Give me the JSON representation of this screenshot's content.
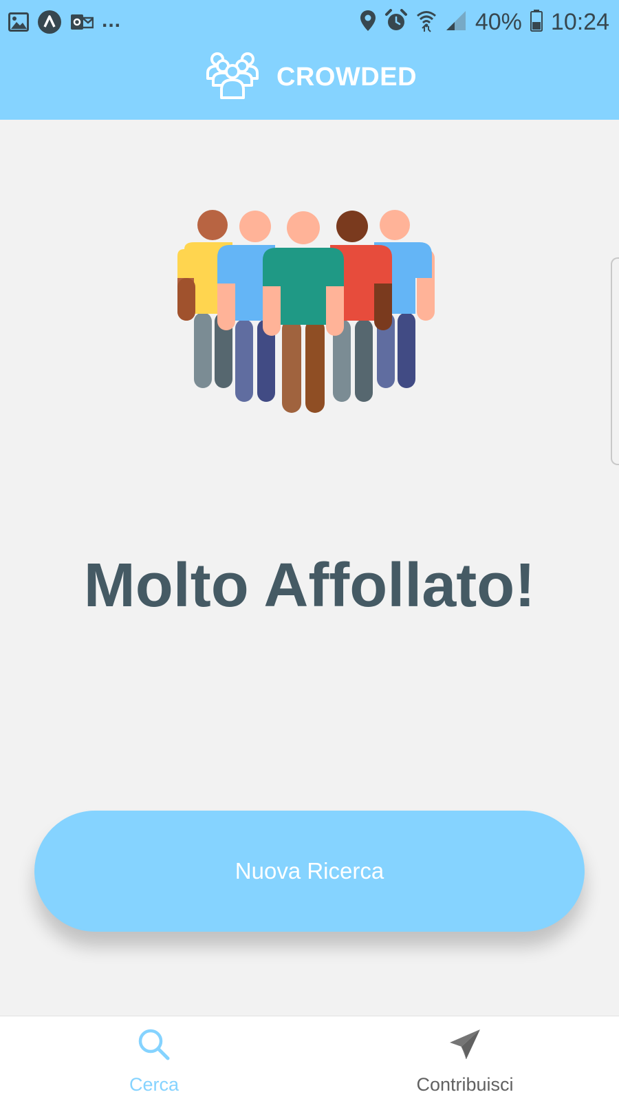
{
  "status_bar": {
    "left_icons": [
      "image-icon",
      "app-icon",
      "outlook-icon"
    ],
    "more": "...",
    "right_icons": [
      "location-icon",
      "alarm-icon",
      "wifi-icon",
      "signal-icon"
    ],
    "battery_percent": "40%",
    "time": "10:24"
  },
  "header": {
    "app_title": "CROWDED",
    "logo_icon": "crowd-logo-icon",
    "background": "#85d3ff"
  },
  "main": {
    "illustration_icon": "crowd-illustration",
    "result_title": "Molto Affollato!",
    "result_color": "#455a64",
    "button_label": "Nuova Ricerca",
    "button_color": "#85d3ff"
  },
  "bottom_nav": {
    "items": [
      {
        "label": "Cerca",
        "icon": "search-icon",
        "active": true
      },
      {
        "label": "Contribuisci",
        "icon": "send-icon",
        "active": false
      }
    ],
    "active_color": "#85d3ff",
    "inactive_color": "#616161"
  }
}
